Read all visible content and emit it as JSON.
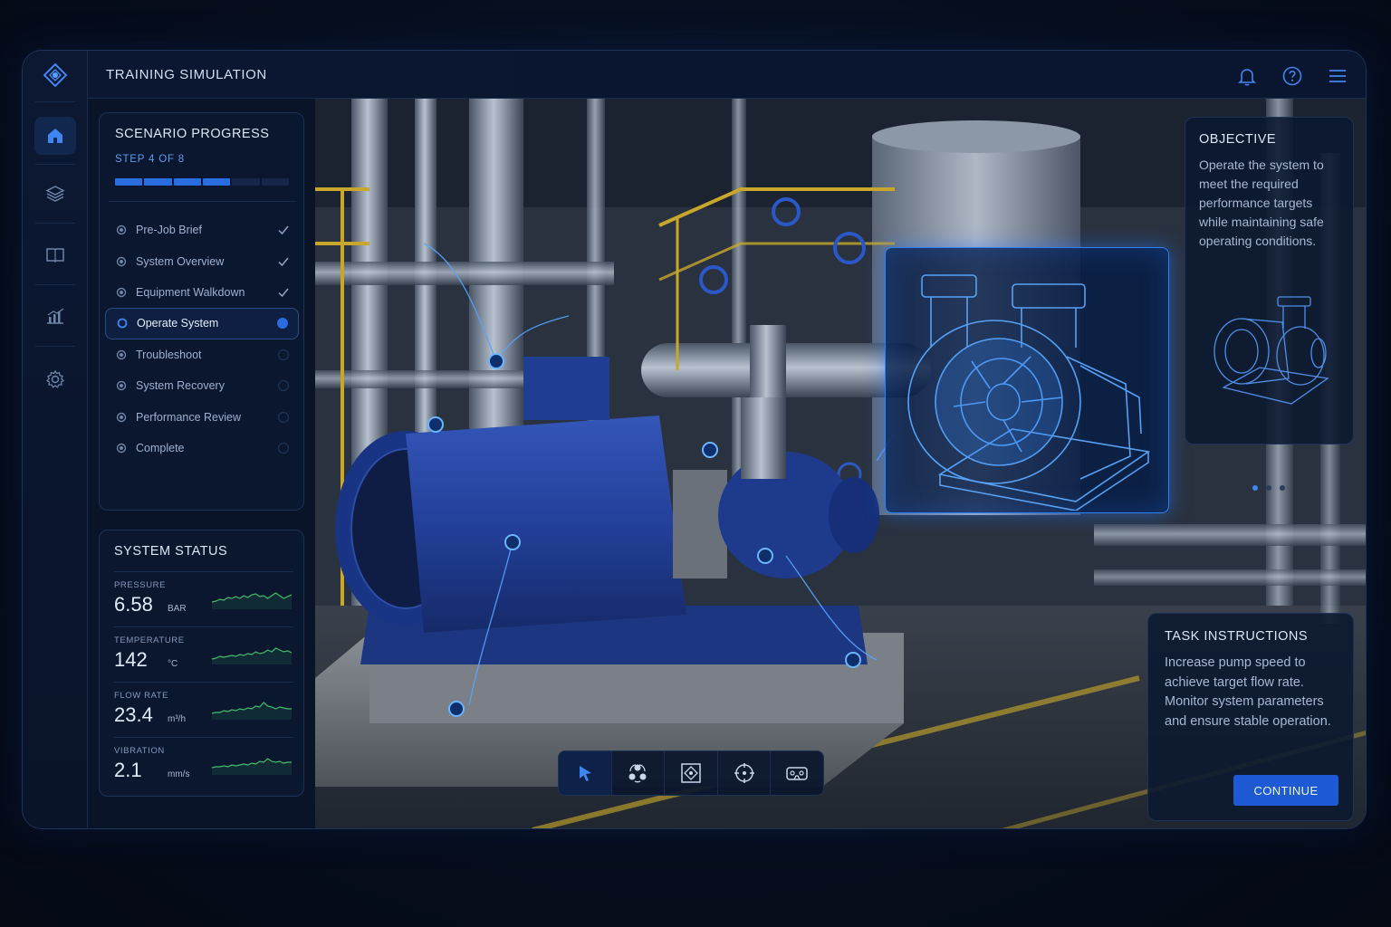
{
  "header": {
    "title": "TRAINING SIMULATION"
  },
  "rail": {
    "items": [
      "home-icon",
      "layers-icon",
      "book-icon",
      "chart-icon",
      "gear-icon"
    ]
  },
  "progress": {
    "title": "SCENARIO PROGRESS",
    "step_text": "STEP 4 OF 8",
    "completed_fraction": 0.5,
    "steps": [
      {
        "label": "Pre-Job Brief",
        "state": "done"
      },
      {
        "label": "System Overview",
        "state": "done"
      },
      {
        "label": "Equipment Walkdown",
        "state": "done"
      },
      {
        "label": "Operate System",
        "state": "current"
      },
      {
        "label": "Troubleshoot",
        "state": "pending"
      },
      {
        "label": "System Recovery",
        "state": "pending"
      },
      {
        "label": "Performance Review",
        "state": "pending"
      },
      {
        "label": "Complete",
        "state": "pending"
      }
    ]
  },
  "status": {
    "title": "SYSTEM STATUS",
    "metrics": [
      {
        "label": "PRESSURE",
        "value": "6.58",
        "unit": "BAR"
      },
      {
        "label": "TEMPERATURE",
        "value": "142",
        "unit": "°C"
      },
      {
        "label": "FLOW RATE",
        "value": "23.4",
        "unit": "m³/h"
      },
      {
        "label": "VIBRATION",
        "value": "2.1",
        "unit": "mm/s"
      }
    ]
  },
  "objective": {
    "title": "OBJECTIVE",
    "text": "Operate the system to meet the required performance targets while maintaining safe operating conditions.",
    "carousel_active": 1,
    "carousel_count": 3
  },
  "task": {
    "title": "TASK INSTRUCTIONS",
    "text": "Increase pump speed to achieve target flow rate. Monitor system parameters and ensure stable operation.",
    "button_label": "CONTINUE"
  },
  "toolbar": {
    "tools": [
      "pointer-icon",
      "orbit-icon",
      "frame-icon",
      "target-icon",
      "vr-icon"
    ],
    "active": 0
  },
  "colors": {
    "accent": "#2a6de0",
    "sparkline": "#3fbf6a",
    "holo": "#2f7ff0"
  }
}
